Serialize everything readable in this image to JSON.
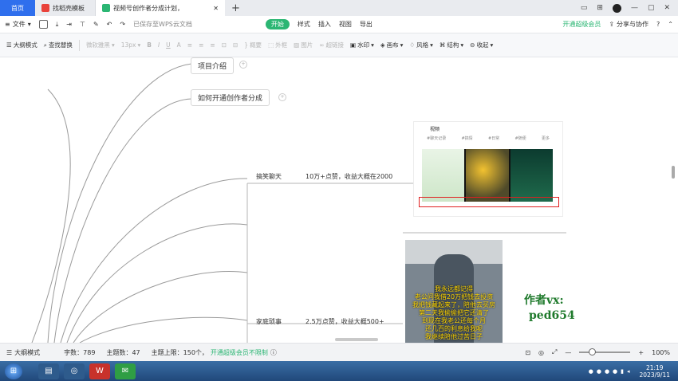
{
  "tabs": {
    "home": "首页",
    "templates": "找稻壳模板",
    "doc": "视频号创作者分成计划，"
  },
  "menu": {
    "file": "文件",
    "saved": "已保存至WPS云文档",
    "start": "开始",
    "style": "样式",
    "insert": "插入",
    "view": "视图",
    "export": "导出",
    "vip": "开通超级会员",
    "share": "分享与协作"
  },
  "toolbar": {
    "outline": "大纲模式",
    "find": "查找替换",
    "font": "微软雅黑",
    "size": "13px",
    "bold": "B",
    "italic": "I",
    "underline": "U",
    "fontcolor": "A",
    "summary": "概要",
    "frame": "外框",
    "image": "图片",
    "link": "超链接",
    "watermark": "水印",
    "canvas": "画布",
    "theme": "风格",
    "structure": "结构",
    "collapse": "收起"
  },
  "mindmap": {
    "node1": "项目介绍",
    "node2": "如何开通创作者分成",
    "branch1": {
      "name": "搞笑聊天",
      "desc": "10万+点赞，收益大概在2000"
    },
    "branch2": {
      "name": "家庭琐事",
      "desc": "2.5万点赞，收益大概500+"
    }
  },
  "shot1": {
    "title": "视频",
    "tabs": [
      "#聊天记录",
      "#搞情",
      "#日常",
      "#随便",
      "更多"
    ]
  },
  "shot2": {
    "caption": [
      "我永远都记得",
      "老公问我借20万把钱去投资",
      "我把钱藏起来了，陪他去买房",
      "第二天我偷偷把它还清了",
      "到现在我老公还每个月",
      "还几百的利息给我呢",
      "我继续陪他过苦日子"
    ]
  },
  "author": {
    "line1": "作者vx:",
    "line2": "ped654"
  },
  "status": {
    "mode": "大纲模式",
    "words": "字数：789",
    "topics": "主题数：47",
    "limit": "主题上限：150个，",
    "vip": "开通超级会员不限制",
    "zoom": "100%"
  },
  "clock": {
    "time": "21:19",
    "date": "2023/9/11"
  },
  "colors": {
    "accent": "#2bb673",
    "tabblue": "#2f6fed",
    "author": "#1f7a2c",
    "highlight": "#e02020"
  }
}
